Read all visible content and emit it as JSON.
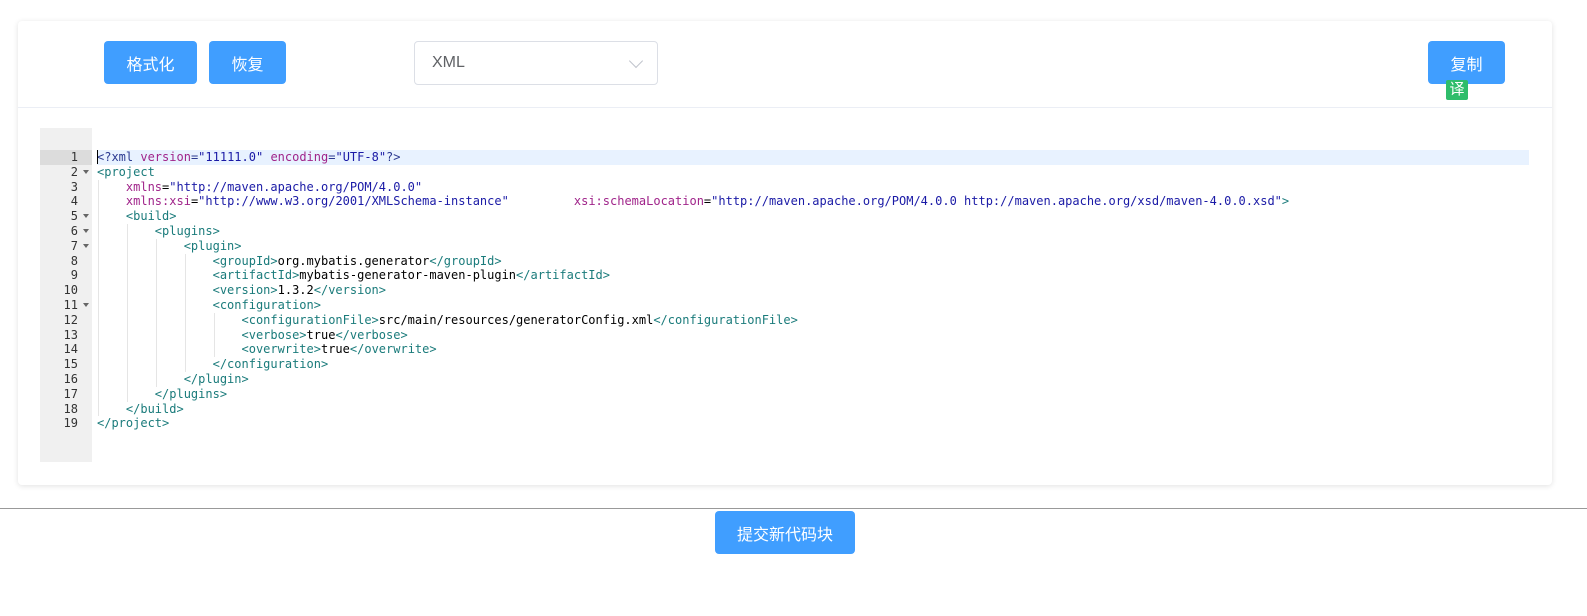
{
  "toolbar": {
    "format_label": "格式化",
    "restore_label": "恢复",
    "language_value": "XML",
    "copy_label": "复制",
    "translate_badge": "译"
  },
  "editor": {
    "active_line": 1,
    "lines": [
      {
        "n": "1",
        "fold": false,
        "indent": 0,
        "tokens": [
          {
            "t": "decl",
            "v": "<?xml "
          },
          {
            "t": "attr",
            "v": "version"
          },
          {
            "t": "decl",
            "v": "="
          },
          {
            "t": "str",
            "v": "\"11111.0\""
          },
          {
            "t": "decl",
            "v": " "
          },
          {
            "t": "attr",
            "v": "encoding"
          },
          {
            "t": "decl",
            "v": "="
          },
          {
            "t": "str",
            "v": "\"UTF-8\""
          },
          {
            "t": "decl",
            "v": "?>"
          }
        ]
      },
      {
        "n": "2",
        "fold": true,
        "indent": 0,
        "tokens": [
          {
            "t": "tag",
            "v": "<project"
          }
        ]
      },
      {
        "n": "3",
        "fold": false,
        "indent": 1,
        "tokens": [
          {
            "t": "attr",
            "v": "xmlns"
          },
          {
            "t": "text",
            "v": "="
          },
          {
            "t": "str",
            "v": "\"http://maven.apache.org/POM/4.0.0\""
          }
        ]
      },
      {
        "n": "4",
        "fold": false,
        "indent": 1,
        "tokens": [
          {
            "t": "attr",
            "v": "xmlns:xsi"
          },
          {
            "t": "text",
            "v": "="
          },
          {
            "t": "str",
            "v": "\"http://www.w3.org/2001/XMLSchema-instance\""
          },
          {
            "t": "text",
            "v": "         "
          },
          {
            "t": "attr",
            "v": "xsi:schemaLocation"
          },
          {
            "t": "text",
            "v": "="
          },
          {
            "t": "str",
            "v": "\"http://maven.apache.org/POM/4.0.0 http://maven.apache.org/xsd/maven-4.0.0.xsd\""
          },
          {
            "t": "tag",
            "v": ">"
          }
        ]
      },
      {
        "n": "5",
        "fold": true,
        "indent": 1,
        "tokens": [
          {
            "t": "tag",
            "v": "<build>"
          }
        ]
      },
      {
        "n": "6",
        "fold": true,
        "indent": 2,
        "tokens": [
          {
            "t": "tag",
            "v": "<plugins>"
          }
        ]
      },
      {
        "n": "7",
        "fold": true,
        "indent": 3,
        "tokens": [
          {
            "t": "tag",
            "v": "<plugin>"
          }
        ]
      },
      {
        "n": "8",
        "fold": false,
        "indent": 4,
        "tokens": [
          {
            "t": "tag",
            "v": "<groupId>"
          },
          {
            "t": "text",
            "v": "org.mybatis.generator"
          },
          {
            "t": "tag",
            "v": "</groupId>"
          }
        ]
      },
      {
        "n": "9",
        "fold": false,
        "indent": 4,
        "tokens": [
          {
            "t": "tag",
            "v": "<artifactId>"
          },
          {
            "t": "text",
            "v": "mybatis-generator-maven-plugin"
          },
          {
            "t": "tag",
            "v": "</artifactId>"
          }
        ]
      },
      {
        "n": "10",
        "fold": false,
        "indent": 4,
        "tokens": [
          {
            "t": "tag",
            "v": "<version>"
          },
          {
            "t": "text",
            "v": "1.3.2"
          },
          {
            "t": "tag",
            "v": "</version>"
          }
        ]
      },
      {
        "n": "11",
        "fold": true,
        "indent": 4,
        "tokens": [
          {
            "t": "tag",
            "v": "<configuration>"
          }
        ]
      },
      {
        "n": "12",
        "fold": false,
        "indent": 5,
        "tokens": [
          {
            "t": "tag",
            "v": "<configurationFile>"
          },
          {
            "t": "text",
            "v": "src/main/resources/generatorConfig.xml"
          },
          {
            "t": "tag",
            "v": "</configurationFile>"
          }
        ]
      },
      {
        "n": "13",
        "fold": false,
        "indent": 5,
        "tokens": [
          {
            "t": "tag",
            "v": "<verbose>"
          },
          {
            "t": "text",
            "v": "true"
          },
          {
            "t": "tag",
            "v": "</verbose>"
          }
        ]
      },
      {
        "n": "14",
        "fold": false,
        "indent": 5,
        "tokens": [
          {
            "t": "tag",
            "v": "<overwrite>"
          },
          {
            "t": "text",
            "v": "true"
          },
          {
            "t": "tag",
            "v": "</overwrite>"
          }
        ]
      },
      {
        "n": "15",
        "fold": false,
        "indent": 4,
        "tokens": [
          {
            "t": "tag",
            "v": "</configuration>"
          }
        ]
      },
      {
        "n": "16",
        "fold": false,
        "indent": 3,
        "tokens": [
          {
            "t": "tag",
            "v": "</plugin>"
          }
        ]
      },
      {
        "n": "17",
        "fold": false,
        "indent": 2,
        "tokens": [
          {
            "t": "tag",
            "v": "</plugins>"
          }
        ]
      },
      {
        "n": "18",
        "fold": false,
        "indent": 1,
        "tokens": [
          {
            "t": "tag",
            "v": "</build>"
          }
        ]
      },
      {
        "n": "19",
        "fold": false,
        "indent": 0,
        "tokens": [
          {
            "t": "tag",
            "v": "</project>"
          }
        ]
      }
    ]
  },
  "footer": {
    "submit_label": "提交新代码块"
  },
  "colors": {
    "primary": "#409eff",
    "translate_badge": "#2fbd6b",
    "tag": "#1a7b7b",
    "attr": "#a0248a",
    "string": "#1a1aa6"
  }
}
